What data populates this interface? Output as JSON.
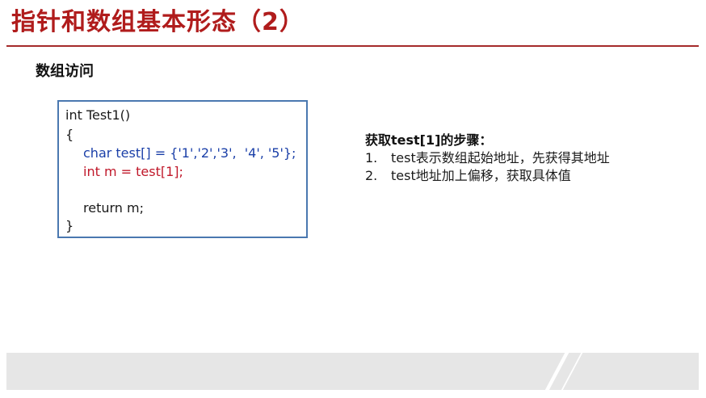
{
  "slide": {
    "title": "指针和数组基本形态（2）",
    "section_heading": "数组访问"
  },
  "code": {
    "lines": [
      "int Test1()",
      "{",
      "char test[] = {'1','2','3',  '4', '5'};",
      "int m = test[1];",
      "",
      "return m;",
      "}"
    ],
    "colors": {
      "default": "#1a1a1a",
      "declaration": "#1a3fa8",
      "highlight": "#c0182a",
      "border": "#4a78b0"
    }
  },
  "steps": {
    "heading": "获取test[1]的步骤：",
    "items": [
      {
        "num": "1.",
        "text": "test表示数组起始地址，先获得其地址"
      },
      {
        "num": "2.",
        "text": "test地址加上偏移，获取具体值"
      }
    ]
  },
  "theme": {
    "title_color": "#b01c1c",
    "rule_color": "#a52a2a",
    "footer_color": "#e6e6e6"
  }
}
